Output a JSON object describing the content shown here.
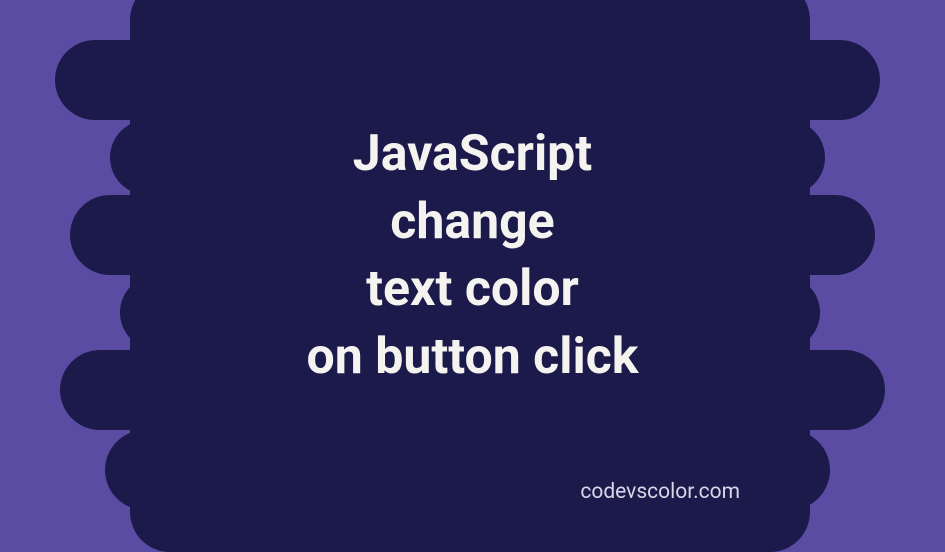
{
  "title": {
    "line1": "JavaScript",
    "line2": "change",
    "line3": "text color",
    "line4": "on button click"
  },
  "footer": "codevscolor.com",
  "colors": {
    "background": "#5a4ba3",
    "shape": "#1c1a4a",
    "text": "#f5f3f0",
    "footer_text": "#d8d6e8"
  }
}
